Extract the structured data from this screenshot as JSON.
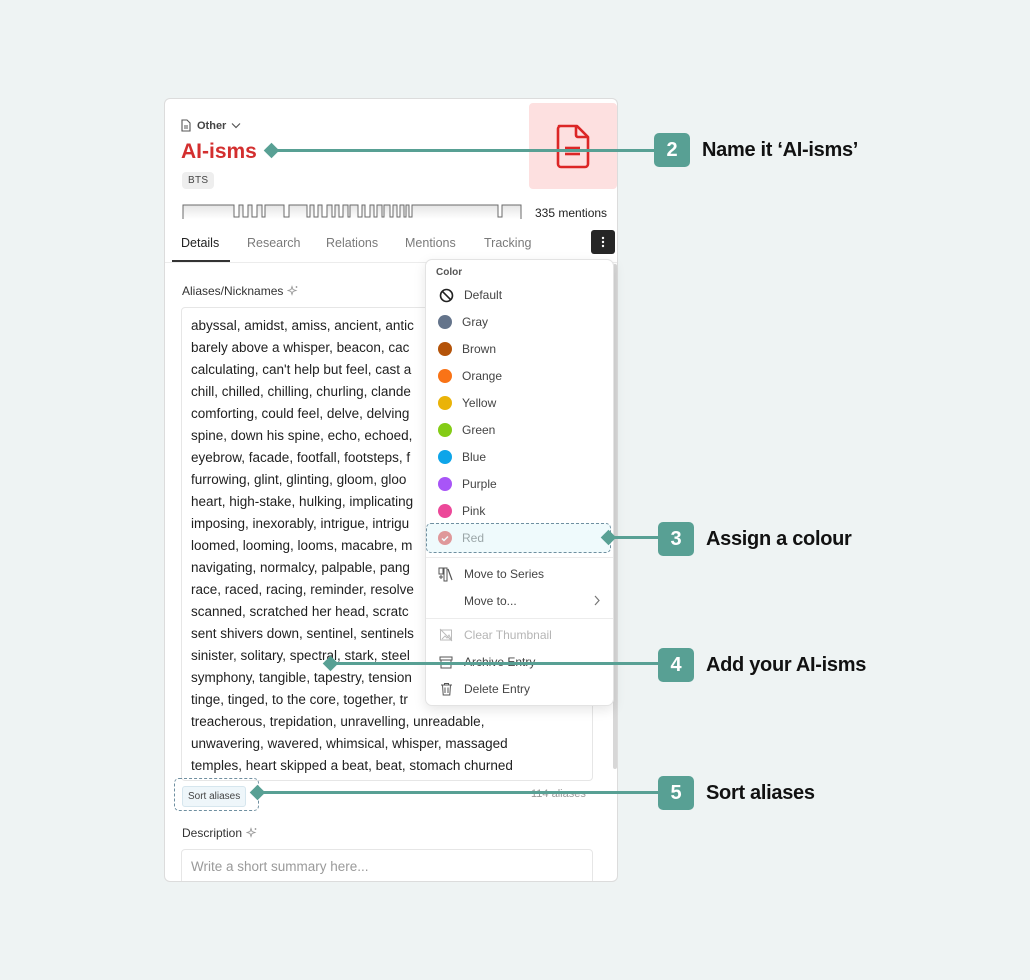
{
  "entry": {
    "category": "Other",
    "title": "AI-isms",
    "tag": "BTS",
    "mentions": "335 mentions",
    "title_color": "#d32f2f",
    "thumbnail_bg": "#fde0e0"
  },
  "tabs": [
    {
      "label": "Details",
      "active": true
    },
    {
      "label": "Research"
    },
    {
      "label": "Relations"
    },
    {
      "label": "Mentions"
    },
    {
      "label": "Tracking"
    }
  ],
  "aliases": {
    "label": "Aliases/Nicknames",
    "lines": [
      "abyssal, amidst, amiss, ancient, antic",
      "barely above a whisper, beacon, cac",
      "calculating, can't help but feel, cast a",
      "chill, chilled, chilling, churling, clande",
      "comforting, could feel, delve, delving",
      "spine, down his spine, echo, echoed,",
      "eyebrow, facade, footfall, footsteps, f",
      "furrowing, glint, glinting, gloom, gloo",
      "heart, high-stake, hulking, implicating",
      "imposing, inexorably, intrigue, intrigu",
      "loomed, looming, looms, macabre, m",
      "navigating, normalcy, palpable, pang",
      "race, raced, racing, reminder, resolve",
      "scanned, scratched her head, scratc",
      "sent shivers down, sentinel, sentinels",
      "sinister, solitary, spectral, stark, steel",
      "symphony, tangible, tapestry, tension",
      "tinge, tinged, to the core, together, tr",
      "treacherous, trepidation, unravelling, unreadable,",
      "unwavering, wavered, whimsical, whisper, massaged",
      "temples, heart skipped a beat, beat, stomach churned"
    ],
    "sort_label": "Sort aliases",
    "count": "114 aliases"
  },
  "description": {
    "label": "Description",
    "placeholder": "Write a short summary here..."
  },
  "menu": {
    "header": "Color",
    "colors": [
      {
        "label": "Default",
        "icon": "no-color-icon"
      },
      {
        "label": "Gray",
        "color": "#64748b"
      },
      {
        "label": "Brown",
        "color": "#b45309"
      },
      {
        "label": "Orange",
        "color": "#f97316"
      },
      {
        "label": "Yellow",
        "color": "#eab308"
      },
      {
        "label": "Green",
        "color": "#84cc16"
      },
      {
        "label": "Blue",
        "color": "#0ea5e9"
      },
      {
        "label": "Purple",
        "color": "#a855f7"
      },
      {
        "label": "Pink",
        "color": "#ec4899"
      },
      {
        "label": "Red",
        "color": "#dc2626",
        "selected": true
      }
    ],
    "actions": [
      {
        "label": "Move to Series",
        "icon": "series-icon"
      },
      {
        "label": "Move to...",
        "icon": "",
        "submenu": true
      }
    ],
    "danger_actions": [
      {
        "label": "Clear Thumbnail",
        "icon": "clear-thumbnail-icon",
        "disabled": true
      },
      {
        "label": "Archive Entry",
        "icon": "archive-icon"
      },
      {
        "label": "Delete Entry",
        "icon": "trash-icon"
      }
    ]
  },
  "annotations": [
    {
      "number": "2",
      "text": "Name it ‘AI-isms’"
    },
    {
      "number": "3",
      "text": "Assign a colour"
    },
    {
      "number": "4",
      "text": "Add your AI-isms"
    },
    {
      "number": "5",
      "text": "Sort aliases"
    }
  ],
  "annotation_color": "#58a094"
}
